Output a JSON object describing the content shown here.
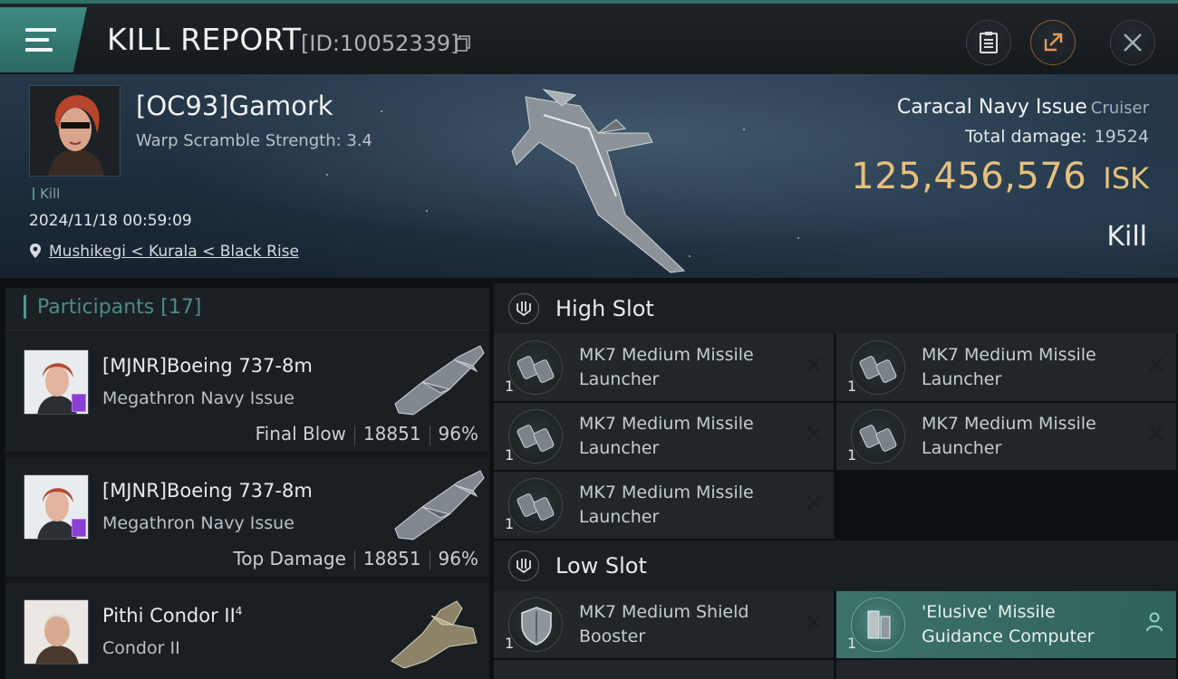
{
  "header": {
    "title": "KILL REPORT",
    "report_id": "[ID:10052339]",
    "icons": [
      "menu-icon",
      "copy-icon",
      "clipboard-icon",
      "share-icon",
      "close-icon"
    ]
  },
  "victim": {
    "pilot": "[OC93]Gamork",
    "warp_scramble": "Warp Scramble Strength: 3.4",
    "tag": "Kill",
    "datetime": "2024/11/18 00:59:09",
    "location": "Mushikegi < Kurala < Black Rise",
    "ship": "Caracal Navy Issue",
    "ship_class": "Cruiser",
    "total_damage_label": "Total damage:",
    "total_damage": "19524",
    "isk_value": "125,456,576",
    "currency": "ISK",
    "result": "Kill"
  },
  "participants": {
    "label": "Participants",
    "count": "[17]",
    "items": [
      {
        "name": "[MJNR]Boeing 737-8m",
        "ship": "Megathron Navy Issue",
        "role": "Final Blow",
        "damage": "18851",
        "percent": "96%"
      },
      {
        "name": "[MJNR]Boeing 737-8m",
        "ship": "Megathron Navy Issue",
        "role": "Top Damage",
        "damage": "18851",
        "percent": "96%"
      },
      {
        "name": "Pithi Condor II",
        "sup": "4",
        "ship": "Condor II"
      }
    ]
  },
  "fitting": {
    "high_slot": {
      "label": "High Slot",
      "modules": [
        {
          "name": "MK7 Medium Missile Launcher",
          "qty": "1"
        },
        {
          "name": "MK7 Medium Missile Launcher",
          "qty": "1"
        },
        {
          "name": "MK7 Medium Missile Launcher",
          "qty": "1"
        },
        {
          "name": "MK7 Medium Missile Launcher",
          "qty": "1"
        },
        {
          "name": "MK7 Medium Missile Launcher",
          "qty": "1"
        }
      ]
    },
    "low_slot": {
      "label": "Low Slot",
      "modules": [
        {
          "name": "MK7 Medium Shield Booster",
          "qty": "1"
        },
        {
          "name": "'Elusive' Missile Guidance Computer",
          "qty": "1"
        }
      ]
    }
  },
  "colors": {
    "accent": "#3f8a80",
    "isk_gold": "#e6c07c",
    "panel": "#1a1f23"
  }
}
